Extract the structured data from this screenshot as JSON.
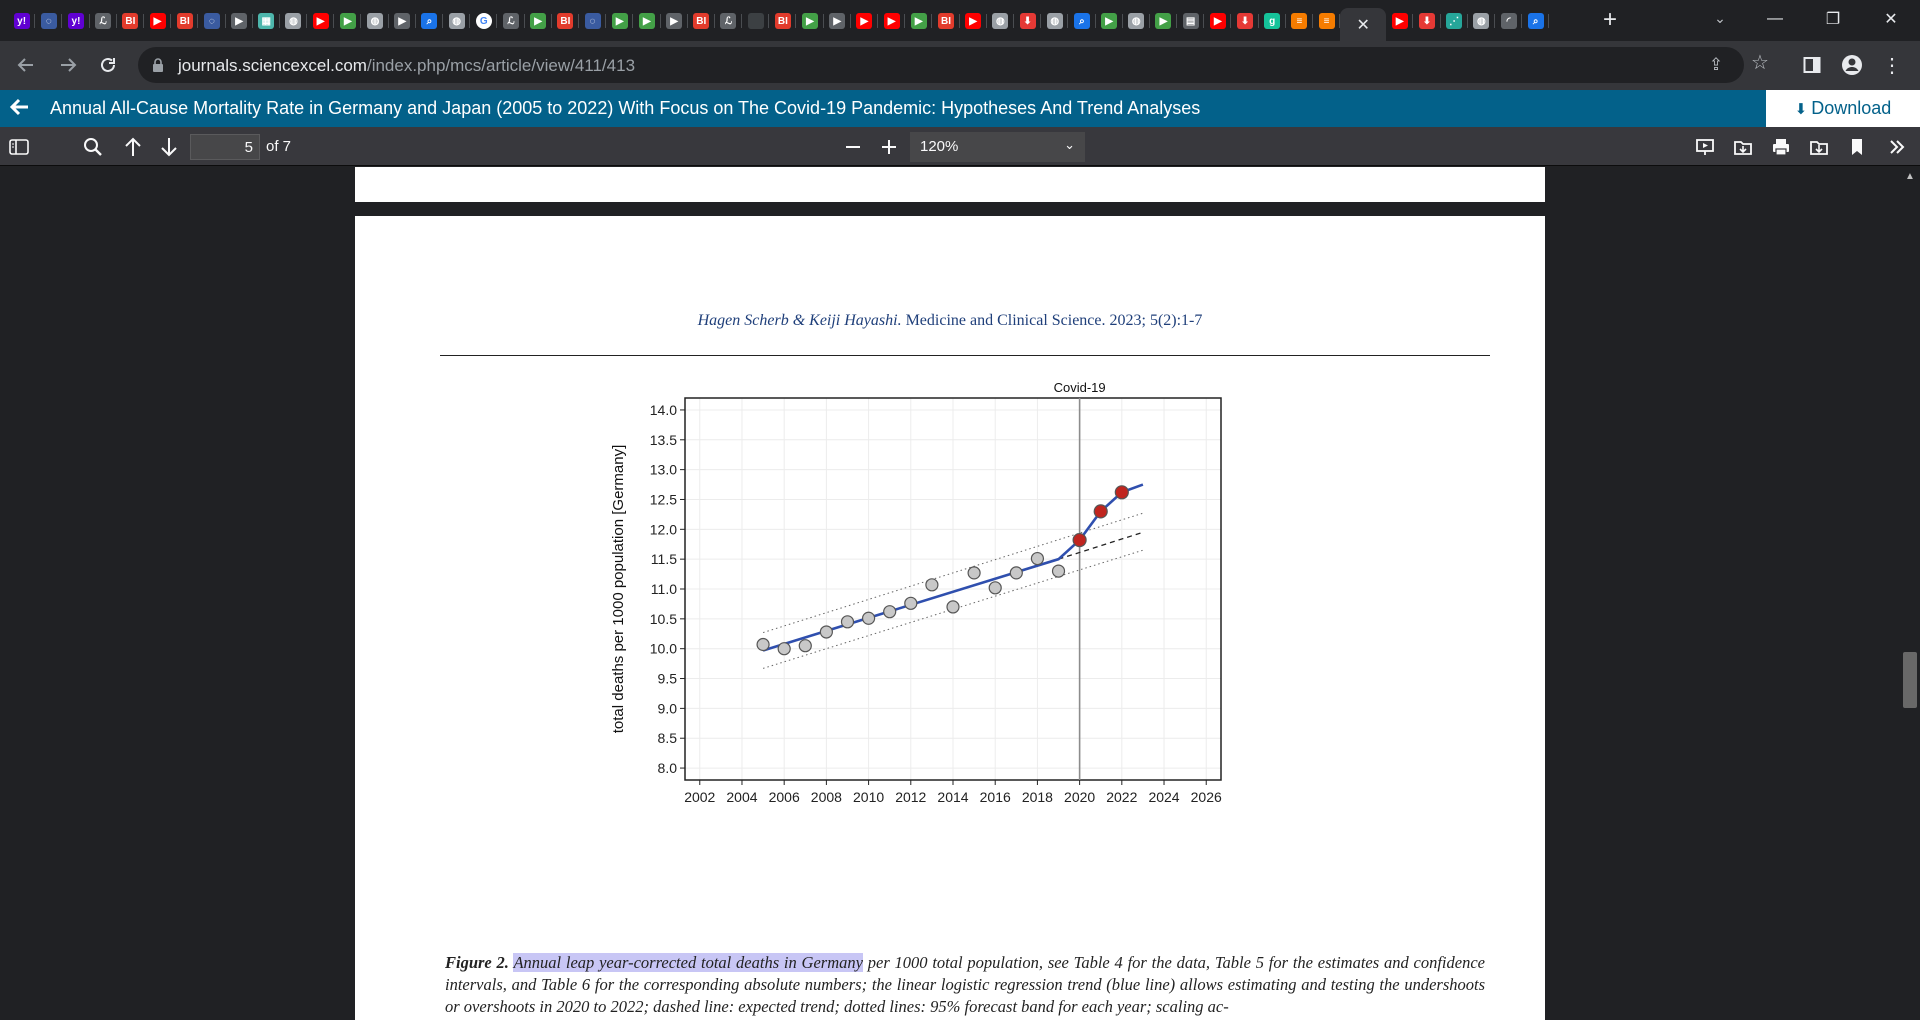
{
  "browser": {
    "tabs": [
      {
        "icon": "yahoo-icon",
        "label": "y!",
        "color": "#6001d2"
      },
      {
        "icon": "shield-icon",
        "label": "◌",
        "color": "#3a5ba0"
      },
      {
        "icon": "yahoo-icon",
        "label": "y!",
        "color": "#6001d2"
      },
      {
        "icon": "letters-icon",
        "label": "ℒ",
        "color": "#5f6368"
      },
      {
        "icon": "bi-icon",
        "label": "BI",
        "color": "#e23b2c"
      },
      {
        "icon": "youtube-icon",
        "label": "▶",
        "color": "#ff0000"
      },
      {
        "icon": "bi-icon",
        "label": "BI",
        "color": "#e23b2c"
      },
      {
        "icon": "shield-icon",
        "label": "◌",
        "color": "#3a5ba0"
      },
      {
        "icon": "bookmark-icon",
        "label": "▶",
        "color": "#5f6368"
      },
      {
        "icon": "map-icon",
        "label": "▦",
        "color": "#4db6ac"
      },
      {
        "icon": "globe-icon",
        "label": "◍",
        "color": "#9aa0a6"
      },
      {
        "icon": "youtube-icon",
        "label": "▶",
        "color": "#ff0000"
      },
      {
        "icon": "play-icon",
        "label": "▶",
        "color": "#43a047"
      },
      {
        "icon": "globe-icon",
        "label": "◍",
        "color": "#9aa0a6"
      },
      {
        "icon": "bookmark-icon",
        "label": "▶",
        "color": "#5f6368"
      },
      {
        "icon": "search-icon",
        "label": "⌕",
        "color": "#1a73e8"
      },
      {
        "icon": "globe-icon",
        "label": "◍",
        "color": "#9aa0a6"
      },
      {
        "icon": "google-icon",
        "label": "G",
        "color": "#ffffff"
      },
      {
        "icon": "letters-icon",
        "label": "ℒ",
        "color": "#5f6368"
      },
      {
        "icon": "play-icon",
        "label": "▶",
        "color": "#43a047"
      },
      {
        "icon": "bi-icon",
        "label": "BI",
        "color": "#e23b2c"
      },
      {
        "icon": "shield-icon",
        "label": "◌",
        "color": "#3a5ba0"
      },
      {
        "icon": "play-icon",
        "label": "▶",
        "color": "#43a047"
      },
      {
        "icon": "play-icon",
        "label": "▶",
        "color": "#43a047"
      },
      {
        "icon": "bookmark-icon",
        "label": "▶",
        "color": "#5f6368"
      },
      {
        "icon": "bi-icon",
        "label": "BI",
        "color": "#e23b2c"
      },
      {
        "icon": "letters-icon",
        "label": "ℒ",
        "color": "#5f6368"
      },
      {
        "icon": "blank-icon",
        "label": "",
        "color": "#3c4043"
      },
      {
        "icon": "bi-icon",
        "label": "BI",
        "color": "#e23b2c"
      },
      {
        "icon": "play-icon",
        "label": "▶",
        "color": "#43a047"
      },
      {
        "icon": "bookmark-icon",
        "label": "▶",
        "color": "#5f6368"
      },
      {
        "icon": "youtube-icon",
        "label": "▶",
        "color": "#ff0000"
      },
      {
        "icon": "youtube-icon",
        "label": "▶",
        "color": "#ff0000"
      },
      {
        "icon": "play-icon",
        "label": "▶",
        "color": "#43a047"
      },
      {
        "icon": "bi-icon",
        "label": "BI",
        "color": "#e23b2c"
      },
      {
        "icon": "youtube-icon",
        "label": "▶",
        "color": "#ff0000"
      },
      {
        "icon": "globe-icon",
        "label": "◍",
        "color": "#9aa0a6"
      },
      {
        "icon": "download-icon",
        "label": "⬇",
        "color": "#e53935"
      },
      {
        "icon": "globe-icon",
        "label": "◍",
        "color": "#9aa0a6"
      },
      {
        "icon": "search-icon",
        "label": "⌕",
        "color": "#1a73e8"
      },
      {
        "icon": "play-icon",
        "label": "▶",
        "color": "#43a047"
      },
      {
        "icon": "globe-icon",
        "label": "◍",
        "color": "#9aa0a6"
      },
      {
        "icon": "play-icon",
        "label": "▶",
        "color": "#43a047"
      },
      {
        "icon": "news-icon",
        "label": "▤",
        "color": "#5f6368"
      },
      {
        "icon": "youtube-icon",
        "label": "▶",
        "color": "#ff0000"
      },
      {
        "icon": "download-icon",
        "label": "⬇",
        "color": "#e53935"
      },
      {
        "icon": "grammarly-icon",
        "label": "g",
        "color": "#15c39a"
      },
      {
        "icon": "book-icon",
        "label": "≡",
        "color": "#f57c00"
      },
      {
        "icon": "book-icon",
        "label": "≡",
        "color": "#f57c00"
      },
      {
        "icon": "close-icon",
        "label": "✕",
        "color": "#35363a",
        "active": true
      },
      {
        "icon": "youtube-icon",
        "label": "▶",
        "color": "#ff0000"
      },
      {
        "icon": "download-icon",
        "label": "⬇",
        "color": "#e53935"
      },
      {
        "icon": "chart-icon",
        "label": "⋰",
        "color": "#26a69a"
      },
      {
        "icon": "globe-icon",
        "label": "◍",
        "color": "#9aa0a6"
      },
      {
        "icon": "loading-icon",
        "label": "◜",
        "color": "#5f6368"
      },
      {
        "icon": "search-icon",
        "label": "⌕",
        "color": "#1a73e8"
      }
    ],
    "new_tab": "+",
    "tab_search": "⌄",
    "minimize": "—",
    "restore": "❐",
    "close": "✕",
    "url_host": "journals.sciencexcel.com",
    "url_path": "/index.php/mcs/article/view/411/413"
  },
  "article_bar": {
    "back": "🡐",
    "title": "Annual All-Cause Mortality Rate in Germany and Japan (2005 to 2022) With Focus on The Covid-19 Pandemic: Hypotheses And Trend Analyses",
    "download_label": "Download",
    "download_icon": "⬇"
  },
  "pdf_toolbar": {
    "page_number": "5",
    "page_count": "of 7",
    "zoom": "120%"
  },
  "page": {
    "running_head_authors": "Hagen Scherb & Keiji Hayashi.",
    "running_head_journal": " Medicine and Clinical Science. 2023; 5(2):1-7",
    "caption_label": "Figure 2.",
    "caption_highlight": "Annual leap year-corrected total deaths in Germany",
    "caption_rest": " per 1000 total population, see Table 4 for the data, Table 5 for the estimates and confidence intervals, and Table 6 for the corresponding absolute numbers; the linear logistic regression trend (blue line) allows estimating and testing the undershoots or overshoots in 2020 to 2022; dashed line: expected trend; dotted lines: 95% forecast band for each year; scaling ac-"
  },
  "chart_data": {
    "type": "scatter",
    "title": "",
    "xlabel": "",
    "ylabel": "total deaths per 1000 population [Germany]",
    "annotation": "Covid-19",
    "xlim": [
      2001.3,
      2026.7
    ],
    "ylim": [
      7.8,
      14.2
    ],
    "x_ticks": [
      "2002",
      "2004",
      "2006",
      "2008",
      "2010",
      "2012",
      "2014",
      "2016",
      "2018",
      "2020",
      "2022",
      "2024",
      "2026"
    ],
    "y_ticks": [
      "8.0",
      "8.5",
      "9.0",
      "9.5",
      "10.0",
      "10.5",
      "11.0",
      "11.5",
      "12.0",
      "12.5",
      "13.0",
      "13.5",
      "14.0"
    ],
    "grid": true,
    "covid_line_x": 2020,
    "observed_pre": {
      "x": [
        2005,
        2006,
        2007,
        2008,
        2009,
        2010,
        2011,
        2012,
        2013,
        2014,
        2015,
        2016,
        2017,
        2018,
        2019
      ],
      "y": [
        10.07,
        10.0,
        10.05,
        10.28,
        10.45,
        10.51,
        10.62,
        10.76,
        11.07,
        10.7,
        11.27,
        11.02,
        11.27,
        11.51,
        11.3
      ],
      "color": "#c8c8c8"
    },
    "observed_covid": {
      "x": [
        2020,
        2021,
        2022
      ],
      "y": [
        11.82,
        12.3,
        12.62
      ],
      "color": "#c0251f"
    },
    "trend": {
      "x": [
        2005,
        2019,
        2020,
        2021,
        2022,
        2023
      ],
      "y": [
        9.97,
        11.5,
        11.82,
        12.3,
        12.62,
        12.75
      ],
      "color": "#2f4fae"
    },
    "expected": {
      "x": [
        2019,
        2023
      ],
      "y": [
        11.5,
        11.95
      ]
    },
    "forecast_upper": {
      "x": [
        2005,
        2023
      ],
      "y": [
        10.27,
        12.27
      ]
    },
    "forecast_lower": {
      "x": [
        2005,
        2023
      ],
      "y": [
        9.67,
        11.65
      ]
    }
  }
}
